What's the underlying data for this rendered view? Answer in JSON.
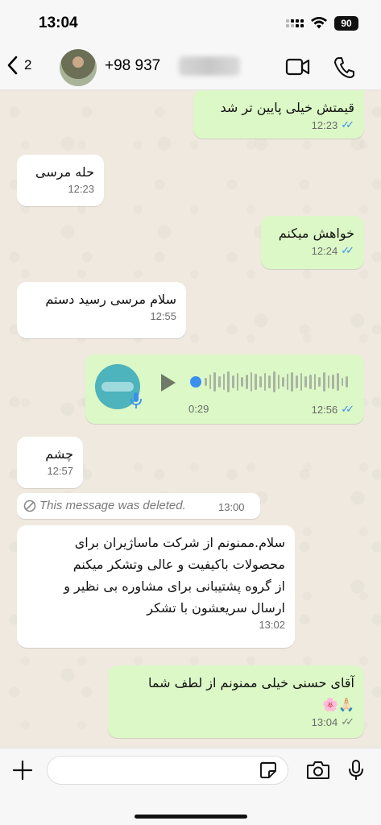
{
  "status": {
    "time": "13:04",
    "battery": "90"
  },
  "header": {
    "back_count": "2",
    "contact_name": "+98 937",
    "icons": [
      "chevron-left-icon",
      "video-call-icon",
      "phone-icon"
    ]
  },
  "messages": [
    {
      "type": "out",
      "text": "قیمتش خیلی پایین تر شد",
      "time": "12:23",
      "ticks": "read"
    },
    {
      "type": "in",
      "text": "حله مرسی",
      "time": "12:23"
    },
    {
      "type": "out",
      "text": "خواهش میکنم",
      "time": "12:24",
      "ticks": "read"
    },
    {
      "type": "in",
      "text": "سلام مرسی رسید دستم",
      "time": "12:55"
    },
    {
      "type": "voice",
      "duration": "0:29",
      "time": "12:56",
      "ticks": "read"
    },
    {
      "type": "in",
      "text": "چشم",
      "time": "12:57"
    },
    {
      "type": "deleted",
      "text": "This message was deleted.",
      "time": "13:00"
    },
    {
      "type": "in",
      "lines": [
        "سلام.ممنونم از شرکت ماساژیران برای",
        "محصولات باکیفیت و عالی وتشکر میکنم",
        "از گروه پشتیبانی برای مشاوره بی نظیر و",
        "ارسال سریعشون با تشکر"
      ],
      "time": "13:02"
    },
    {
      "type": "out",
      "lines": [
        "آقای حسنی خیلی ممنونم از لطف شما",
        "🙏🏻🌸"
      ],
      "time": "13:04",
      "ticks": "delivered"
    }
  ],
  "input": {
    "placeholder": "",
    "icons": [
      "plus-icon",
      "sticker-icon",
      "camera-icon",
      "mic-icon"
    ]
  },
  "colors": {
    "outgoing": "#dbf8c6",
    "incoming": "#ffffff",
    "read_tick": "#3b8ff0",
    "wallpaper": "#efe9df"
  }
}
